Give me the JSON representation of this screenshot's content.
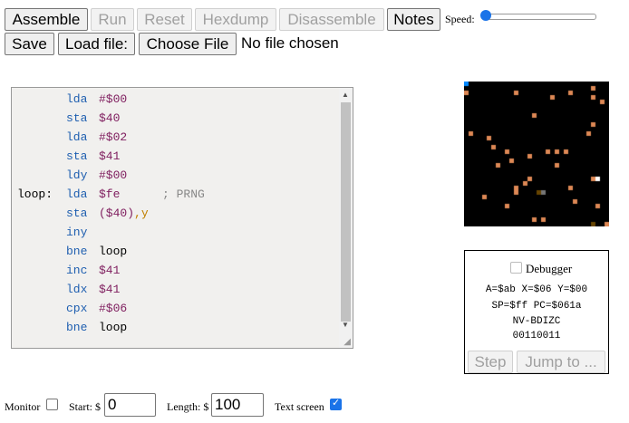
{
  "toolbar": {
    "assemble": "Assemble",
    "run": "Run",
    "reset": "Reset",
    "hexdump": "Hexdump",
    "disassemble": "Disassemble",
    "notes": "Notes",
    "speed_label": "Speed:",
    "speed_value": 0,
    "save": "Save",
    "load_file": "Load file:",
    "choose_file": "Choose File",
    "no_file": "No file chosen"
  },
  "editor": {
    "lines": [
      {
        "label": "",
        "op": "lda",
        "arg": "#$00",
        "comment": ""
      },
      {
        "label": "",
        "op": "sta",
        "arg": "$40",
        "comment": ""
      },
      {
        "label": "",
        "op": "lda",
        "arg": "#$02",
        "comment": ""
      },
      {
        "label": "",
        "op": "sta",
        "arg": "$41",
        "comment": ""
      },
      {
        "label": "",
        "op": "ldy",
        "arg": "#$00",
        "comment": ""
      },
      {
        "label": "loop:",
        "op": "lda",
        "arg": "$fe",
        "comment": "; PRNG"
      },
      {
        "label": "",
        "op": "sta",
        "arg": "($40),y",
        "comment": ""
      },
      {
        "label": "",
        "op": "iny",
        "arg": "",
        "comment": ""
      },
      {
        "label": "",
        "op": "bne",
        "arg": "loop",
        "comment": ""
      },
      {
        "label": "",
        "op": "inc",
        "arg": "$41",
        "comment": ""
      },
      {
        "label": "",
        "op": "ldx",
        "arg": "$41",
        "comment": ""
      },
      {
        "label": "",
        "op": "cpx",
        "arg": "#$06",
        "comment": ""
      },
      {
        "label": "",
        "op": "bne",
        "arg": "loop",
        "comment": ""
      }
    ]
  },
  "screen": {
    "palette": [
      "#000000",
      "#ffffff",
      "#880000",
      "#aaffee",
      "#cc44cc",
      "#00cc55",
      "#0000aa",
      "#eeee77",
      "#dd8855",
      "#664400",
      "#ff7777",
      "#333333",
      "#777777",
      "#aaff66",
      "#0088ff",
      "#bbbbbb"
    ]
  },
  "debugger": {
    "label": "Debugger",
    "enabled": false,
    "line1": "A=$ab X=$06 Y=$00",
    "line2": "SP=$ff PC=$061a",
    "line3": "NV-BDIZC",
    "line4": "00110011",
    "step": "Step",
    "jump": "Jump to ..."
  },
  "monitor": {
    "label": "Monitor",
    "enabled": false,
    "start_label": "Start: $",
    "start_value": "0",
    "length_label": "Length: $",
    "length_value": "100",
    "text_screen_label": "Text screen",
    "text_screen": true
  }
}
